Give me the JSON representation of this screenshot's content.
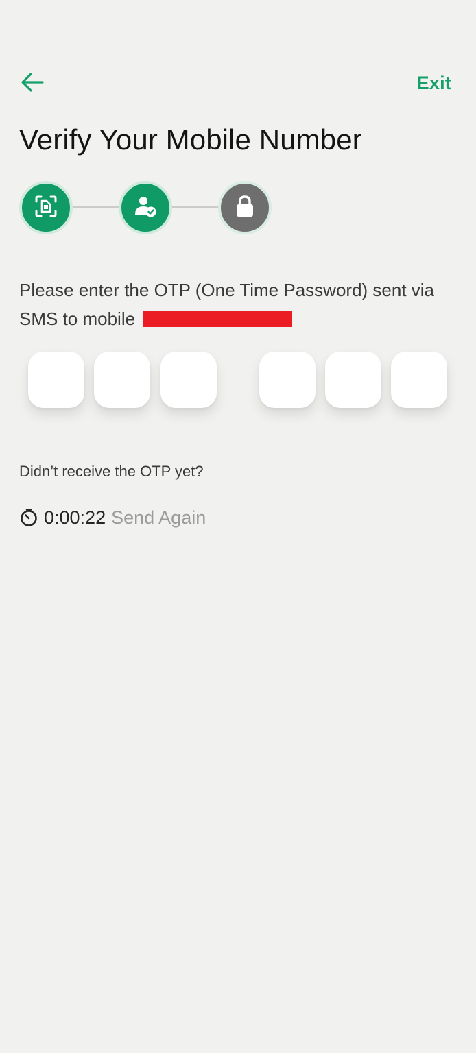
{
  "header": {
    "back_icon": "arrow-left-icon",
    "exit_label": "Exit",
    "accent_color": "#14a06a"
  },
  "title": "Verify Your Mobile Number",
  "stepper": {
    "steps": [
      {
        "icon": "id-scan-icon",
        "state": "completed"
      },
      {
        "icon": "user-check-icon",
        "state": "completed"
      },
      {
        "icon": "lock-icon",
        "state": "current"
      }
    ],
    "completed_color": "#0f9a66",
    "current_color": "#6e6e6e"
  },
  "instruction": {
    "text": "Please enter the OTP (One Time Password) sent via SMS to mobile",
    "redaction_color": "#ec1c24"
  },
  "otp": {
    "digits": [
      "",
      "",
      "",
      "",
      "",
      ""
    ]
  },
  "resend": {
    "question": "Didn’t receive the OTP yet?",
    "timer_icon": "timer-icon",
    "timer_value": "0:00:22",
    "send_again_label": "Send Again"
  }
}
